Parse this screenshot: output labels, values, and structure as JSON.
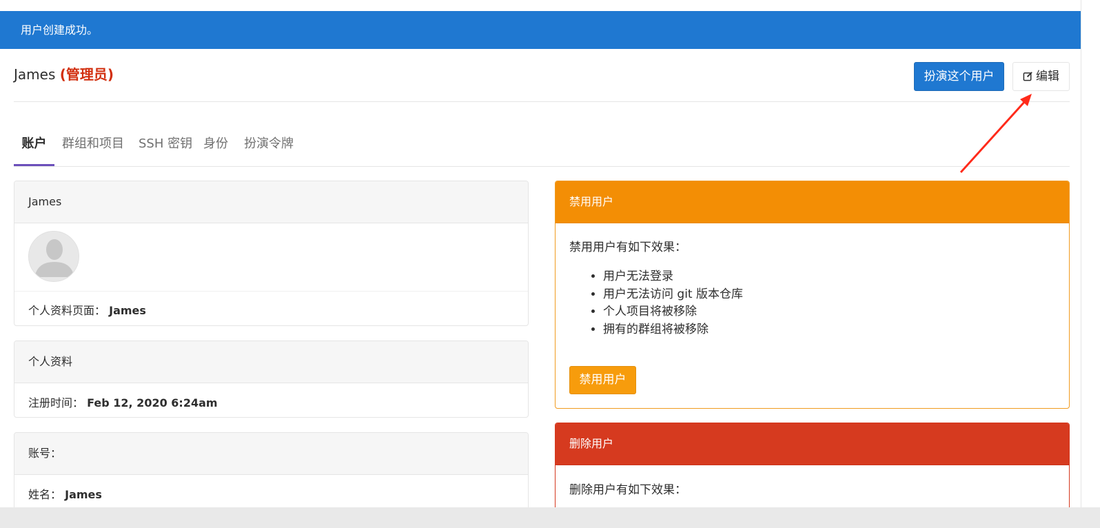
{
  "flash": {
    "message": "用户创建成功。"
  },
  "header": {
    "name": "James",
    "admin_tag": "(管理员)",
    "impersonate_label": "扮演这个用户",
    "edit_label": "编辑"
  },
  "tabs": [
    {
      "label": "账户",
      "active": true
    },
    {
      "label": "群组和项目"
    },
    {
      "label": "SSH 密钥"
    },
    {
      "label": "身份"
    },
    {
      "label": "扮演令牌"
    }
  ],
  "profile_card": {
    "title": "James",
    "profile_page_label": "个人资料页面：",
    "profile_page_value": "James"
  },
  "personal_card": {
    "title": "个人资料",
    "registered_label": "注册时间：",
    "registered_value": "Feb 12, 2020 6:24am"
  },
  "account_card": {
    "title": "账号：",
    "name_label": "姓名：",
    "name_value": "James"
  },
  "block_card": {
    "title": "禁用用户",
    "intro": "禁用用户有如下效果：",
    "effects": [
      "用户无法登录",
      "用户无法访问 git 版本仓库",
      "个人项目将被移除",
      "拥有的群组将被移除"
    ],
    "button_label": "禁用用户"
  },
  "delete_card": {
    "title": "删除用户",
    "intro": "删除用户有如下效果："
  },
  "colors": {
    "primary": "#1f78d1",
    "warning": "#f38e05",
    "danger": "#d63a1f",
    "admin": "#d22f0f",
    "annotation_arrow": "#ff2a1a"
  }
}
